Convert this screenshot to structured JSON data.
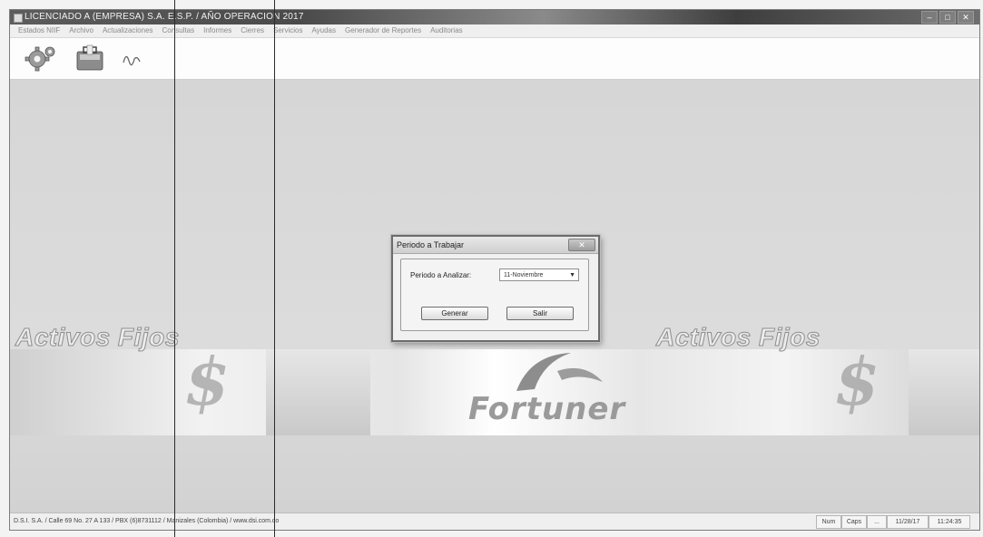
{
  "window": {
    "title": "LICENCIADO A (EMPRESA) S.A. E.S.P. / AÑO OPERACION 2017",
    "controls": {
      "minimize": "–",
      "maximize": "□",
      "close": "✕"
    }
  },
  "menu": {
    "items": [
      "Estados NIIF",
      "Archivo",
      "Actualizaciones",
      "Consultas",
      "Informes",
      "Cierres",
      "Servicios",
      "Ayudas",
      "Generador de Reportes",
      "Auditorias"
    ]
  },
  "toolbar": {
    "icons": [
      "gear-icon",
      "briefcase-icon",
      "signature-icon"
    ]
  },
  "background": {
    "watermark_left": "Activos Fijos",
    "watermark_right": "Activos Fijos",
    "dollar_glyph": "$",
    "brand": "Fortuner"
  },
  "dialog": {
    "title": "Periodo a Trabajar",
    "field_label": "Periodo a Analizar:",
    "selected_period": "11-Noviembre",
    "ok_button": "Generar",
    "cancel_button": "Salir"
  },
  "status": {
    "left_text": "D.S.I. S.A. / Calle 69 No. 27 A 133 / PBX (6)8731112 / Manizales (Colombia) / www.dsi.com.co",
    "num": "Num",
    "caps": "Caps",
    "scroll": "...",
    "date": "11/28/17",
    "time": "11:24:35"
  }
}
